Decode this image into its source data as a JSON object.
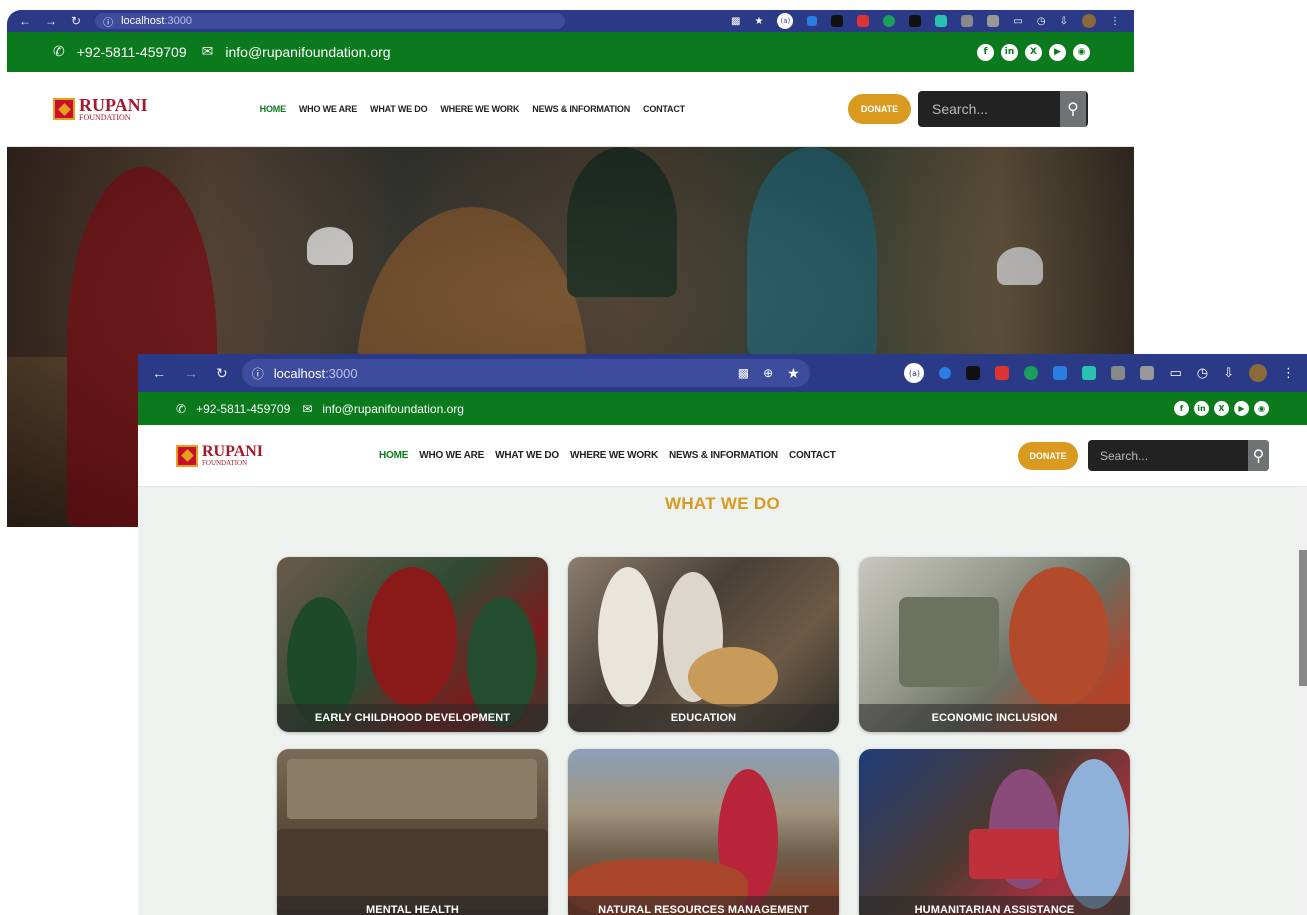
{
  "browser": {
    "url_host": "localhost",
    "url_port": ":3000",
    "back_url_host": "localhost",
    "back_url_port": ":3000"
  },
  "topbar": {
    "phone": "+92-5811-459709",
    "email": "info@rupanifoundation.org",
    "socials": [
      "facebook-icon",
      "linkedin-icon",
      "x-icon",
      "youtube-icon",
      "instagram-icon"
    ]
  },
  "brand": {
    "name": "RUPANI",
    "sub": "FOUNDATION"
  },
  "nav": {
    "items": [
      "HOME",
      "WHO WE ARE",
      "WHAT WE DO",
      "WHERE WE WORK",
      "NEWS & INFORMATION",
      "CONTACT"
    ],
    "active": "HOME",
    "donate": "DONATE",
    "search_placeholder": "Search..."
  },
  "section": {
    "title": "WHAT WE DO"
  },
  "cards": [
    {
      "label": "EARLY CHILDHOOD DEVELOPMENT"
    },
    {
      "label": "EDUCATION"
    },
    {
      "label": "ECONOMIC INCLUSION"
    },
    {
      "label": "MENTAL HEALTH"
    },
    {
      "label": "NATURAL RESOURCES MANAGEMENT"
    },
    {
      "label": "HUMANITARIAN ASSISTANCE"
    }
  ],
  "colors": {
    "brand_green": "#0b7a1c",
    "accent_gold": "#d99a1f",
    "browser_bar": "#2b3a86"
  }
}
